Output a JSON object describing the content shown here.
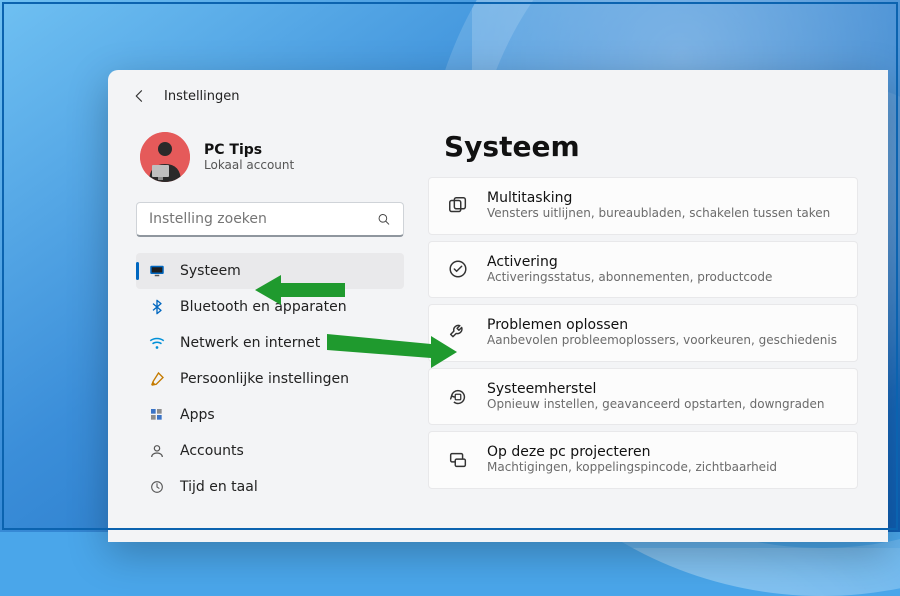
{
  "header": {
    "title": "Instellingen"
  },
  "profile": {
    "name": "PC Tips",
    "sub": "Lokaal account"
  },
  "search": {
    "placeholder": "Instelling zoeken"
  },
  "sidebar": {
    "items": [
      {
        "label": "Systeem"
      },
      {
        "label": "Bluetooth en apparaten"
      },
      {
        "label": "Netwerk en internet"
      },
      {
        "label": "Persoonlijke instellingen"
      },
      {
        "label": "Apps"
      },
      {
        "label": "Accounts"
      },
      {
        "label": "Tijd en taal"
      }
    ]
  },
  "page_title": "Systeem",
  "options": [
    {
      "title": "Multitasking",
      "desc": "Vensters uitlijnen, bureaubladen, schakelen tussen taken"
    },
    {
      "title": "Activering",
      "desc": "Activeringsstatus, abonnementen, productcode"
    },
    {
      "title": "Problemen oplossen",
      "desc": "Aanbevolen probleemoplossers, voorkeuren, geschiedenis"
    },
    {
      "title": "Systeemherstel",
      "desc": "Opnieuw instellen, geavanceerd opstarten, downgraden"
    },
    {
      "title": "Op deze pc projecteren",
      "desc": "Machtigingen, koppelingspincode, zichtbaarheid"
    }
  ],
  "colors": {
    "arrow": "#1f9a2e",
    "accent": "#0067c0"
  }
}
